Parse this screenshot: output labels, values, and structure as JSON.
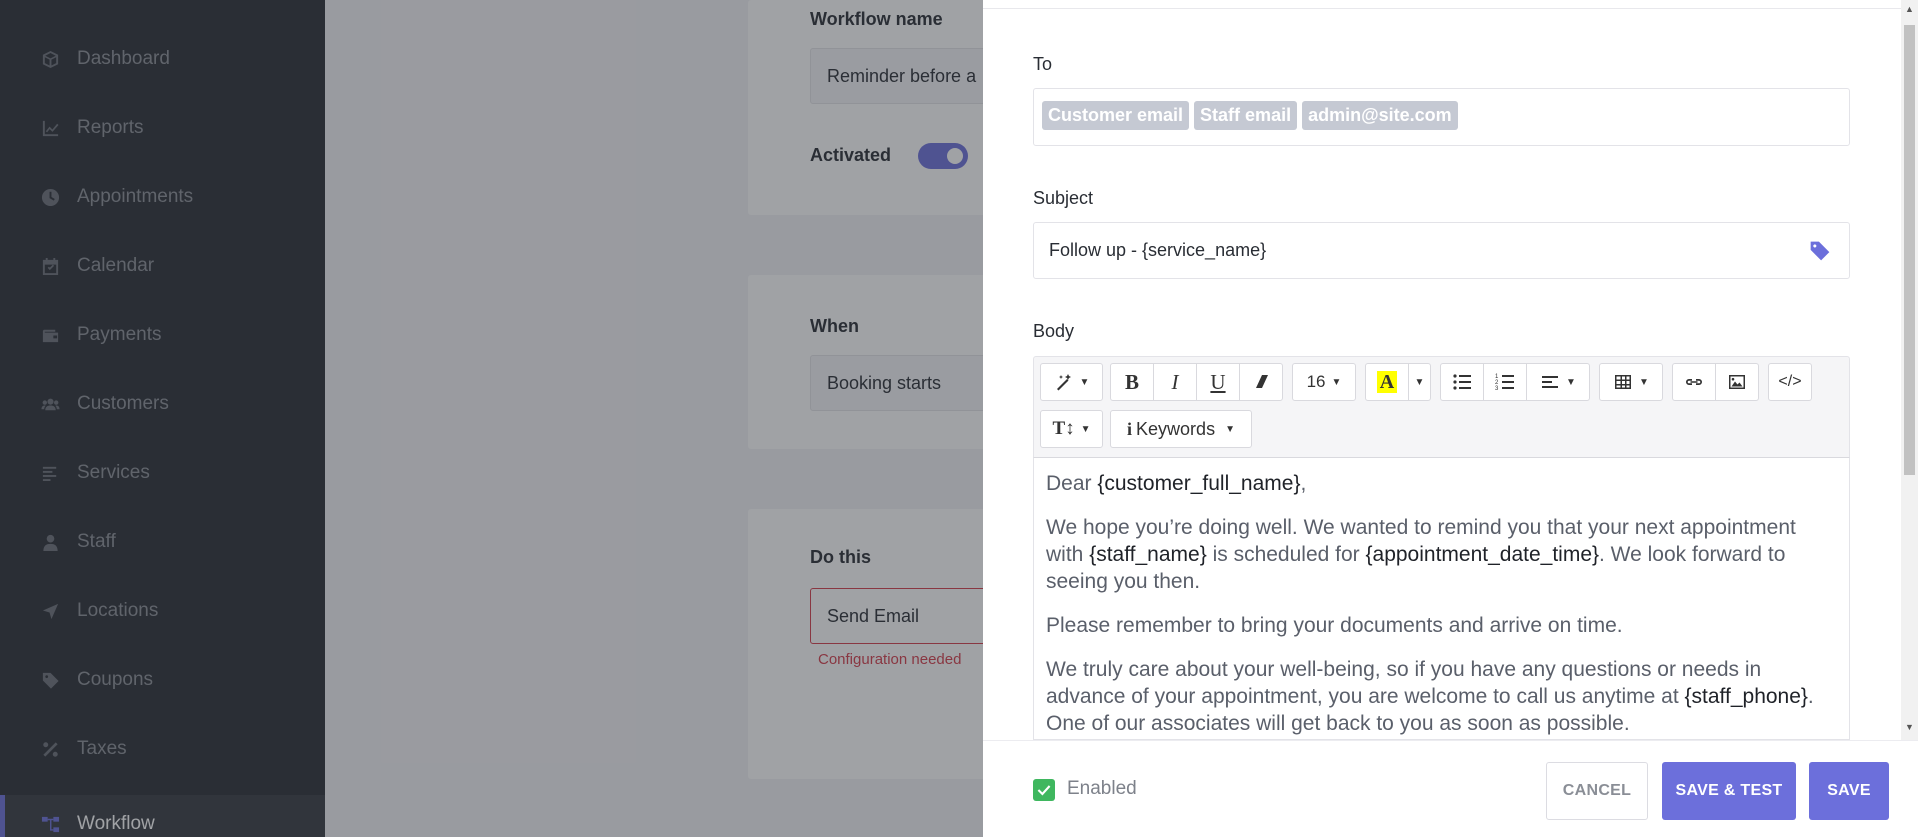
{
  "sidebar": {
    "items": [
      {
        "label": "Dashboard",
        "icon": "cube-icon"
      },
      {
        "label": "Reports",
        "icon": "chart-line-icon"
      },
      {
        "label": "Appointments",
        "icon": "clock-icon"
      },
      {
        "label": "Calendar",
        "icon": "calendar-icon"
      },
      {
        "label": "Payments",
        "icon": "wallet-icon"
      },
      {
        "label": "Customers",
        "icon": "users-icon"
      },
      {
        "label": "Services",
        "icon": "list-icon"
      },
      {
        "label": "Staff",
        "icon": "user-icon"
      },
      {
        "label": "Locations",
        "icon": "location-arrow-icon"
      },
      {
        "label": "Coupons",
        "icon": "tag-icon"
      },
      {
        "label": "Taxes",
        "icon": "percent-icon"
      },
      {
        "label": "Workflow",
        "icon": "workflow-icon",
        "active": true
      }
    ]
  },
  "background": {
    "workflow_name_label": "Workflow name",
    "workflow_name_value": "Reminder before a",
    "activated_label": "Activated",
    "when_label": "When",
    "when_value": "Booking starts",
    "do_this_label": "Do this",
    "do_this_value": "Send Email",
    "config_error": "Configuration needed"
  },
  "panel": {
    "to_label": "To",
    "recipients": [
      "Customer email",
      "Staff email",
      "admin@site.com"
    ],
    "subject_label": "Subject",
    "subject_value": "Follow up - {service_name}",
    "body_label": "Body",
    "toolbar": {
      "font_size": "16",
      "keywords_label": "Keywords"
    },
    "body": {
      "p1_a": "Dear ",
      "p1_kw": "{customer_full_name}",
      "p1_b": ",",
      "p2_a": "We hope you’re doing well. We wanted to remind you that your next appointment with ",
      "p2_kw1": "{staff_name}",
      "p2_b": " is scheduled for ",
      "p2_kw2": "{appointment_date_time}",
      "p2_c": ". We look forward to seeing you then.",
      "p3": "Please remember to bring your documents and arrive on time.",
      "p4_a": "We truly care about your well-being, so if you have any questions or needs in advance of your appointment, you are welcome to call us anytime at ",
      "p4_kw": "{staff_phone}",
      "p4_b": ". One of our associates will get back to you as soon as possible."
    },
    "footer": {
      "enabled_label": "Enabled",
      "enabled": true,
      "cancel_label": "CANCEL",
      "save_test_label": "SAVE & TEST",
      "save_label": "SAVE"
    }
  },
  "colors": {
    "accent": "#6c6fdb",
    "sidebar_bg": "#292d34",
    "error": "#d53c4b",
    "success": "#3fb75f"
  }
}
